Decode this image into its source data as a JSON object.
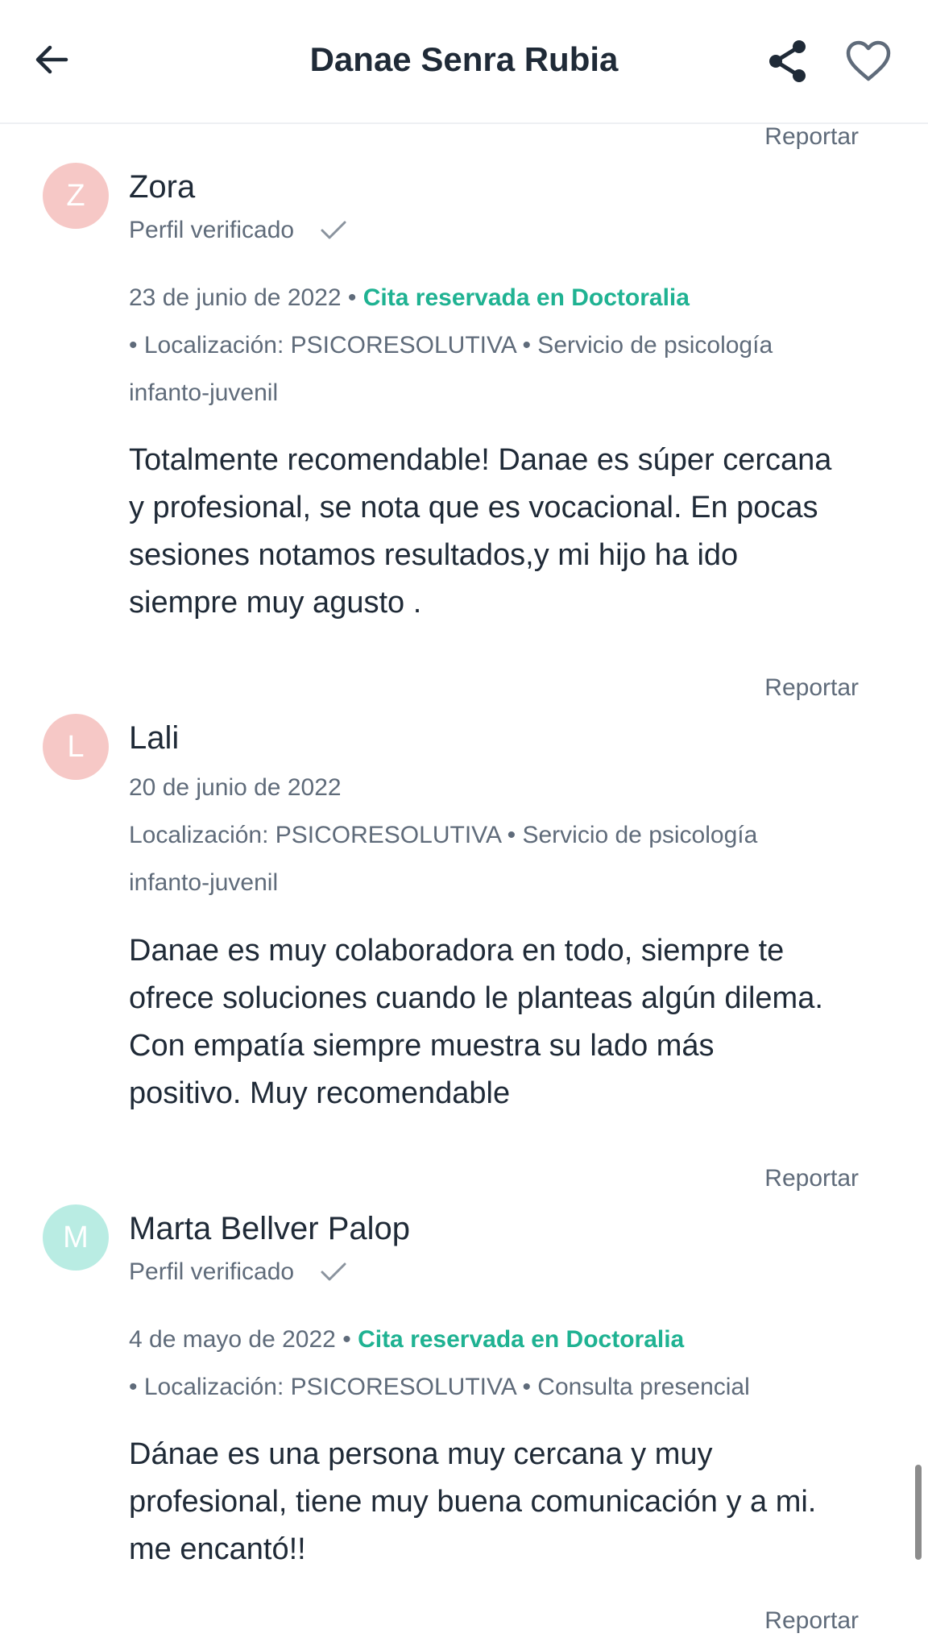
{
  "header": {
    "title": "Danae Senra Rubia",
    "back_icon": "arrow-left-icon",
    "share_icon": "share-icon",
    "favorite_icon": "heart-outline-icon"
  },
  "colors": {
    "accent": "#1fb292",
    "text": "#1f2a37",
    "muted": "#5f6b7a",
    "avatar_pink": "#f6c8c6",
    "avatar_teal": "#b9ece3"
  },
  "report_label": "Reportar",
  "reviews": [
    {
      "initial": "Z",
      "name": "Zora",
      "verified": "Perfil verificado",
      "date": "23 de junio de 2022",
      "separator": " • ",
      "booked": "Cita reservada en Doctoralia",
      "location_line1": "• Localización: PSICORESOLUTIVA • Servicio de psicología",
      "location_line2": "infanto-juvenil",
      "text_lines": [
        "Totalmente recomendable! Danae es súper cercana",
        "y profesional, se nota que es vocacional. En pocas",
        "sesiones notamos resultados,y mi hijo ha ido",
        "siempre muy agusto ."
      ]
    },
    {
      "initial": "L",
      "name": "Lali",
      "date": "20 de junio de 2022",
      "location_line1": "Localización: PSICORESOLUTIVA • Servicio de psicología",
      "location_line2": "infanto-juvenil",
      "text_lines": [
        "Danae es muy colaboradora en todo, siempre te",
        "ofrece soluciones cuando le planteas algún dilema.",
        "Con empatía siempre muestra su lado más",
        "positivo. Muy recomendable"
      ]
    },
    {
      "initial": "M",
      "name": "Marta Bellver Palop",
      "verified": "Perfil verificado",
      "date": "4 de mayo de 2022",
      "separator": " • ",
      "booked": "Cita reservada en Doctoralia",
      "location_line1": "• Localización: PSICORESOLUTIVA • Consulta presencial",
      "text_lines": [
        "Dánae es una persona muy cercana y muy",
        "profesional, tiene muy buena comunicación y a mi.",
        "me encantó!!"
      ]
    }
  ]
}
